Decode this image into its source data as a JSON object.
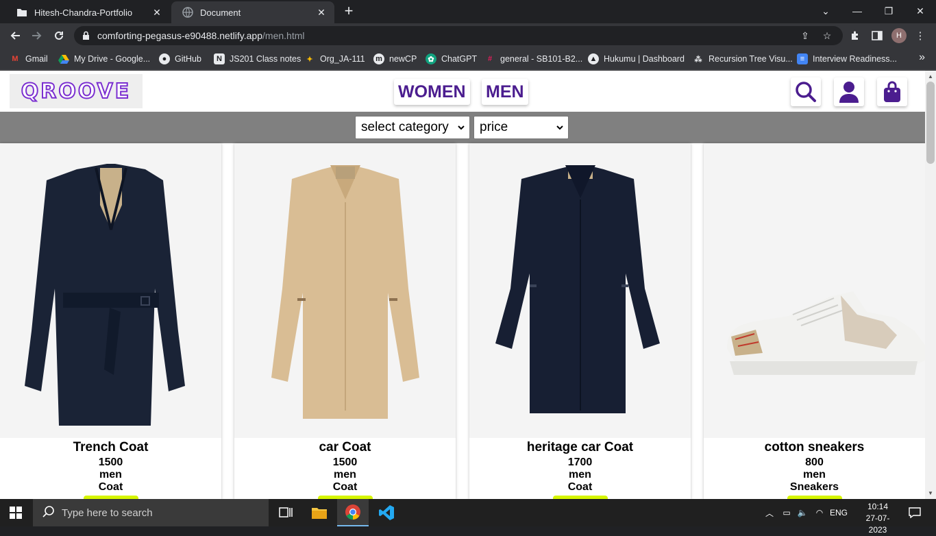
{
  "browser": {
    "tabs": [
      {
        "title": "Hitesh-Chandra-Portfolio",
        "icon": "folder-icon",
        "active": false
      },
      {
        "title": "Document",
        "icon": "globe-icon",
        "active": true
      }
    ],
    "url_host": "comforting-pegasus-e90488.netlify.app",
    "url_path": "/men.html",
    "profile_initial": "H",
    "bookmarks": [
      {
        "label": "Gmail",
        "icon": "gmail-icon"
      },
      {
        "label": "My Drive - Google...",
        "icon": "drive-icon"
      },
      {
        "label": "GitHub",
        "icon": "github-icon"
      },
      {
        "label": "JS201 Class notes",
        "icon": "notion-icon"
      },
      {
        "label": "Org_JA-111",
        "icon": "sparkle-icon"
      },
      {
        "label": "newCP",
        "icon": "m-icon"
      },
      {
        "label": "ChatGPT",
        "icon": "chatgpt-icon"
      },
      {
        "label": "general - SB101-B2...",
        "icon": "slack-icon"
      },
      {
        "label": "Hukumu | Dashboard",
        "icon": "triangle-icon"
      },
      {
        "label": "Recursion Tree Visu...",
        "icon": "tree-icon"
      },
      {
        "label": "Interview Readiness...",
        "icon": "doc-icon"
      }
    ]
  },
  "site": {
    "logo": "QROOVE",
    "nav": {
      "women": "WOMEN",
      "men": "MEN"
    },
    "filters": {
      "category": "select category",
      "price": "price"
    },
    "accent": "#4b1d8f",
    "products": [
      {
        "name": "Trench Coat",
        "price": "1500",
        "gender": "men",
        "category": "Coat"
      },
      {
        "name": "car Coat",
        "price": "1500",
        "gender": "men",
        "category": "Coat"
      },
      {
        "name": "heritage car Coat",
        "price": "1700",
        "gender": "men",
        "category": "Coat"
      },
      {
        "name": "cotton sneakers",
        "price": "800",
        "gender": "men",
        "category": "Sneakers"
      }
    ]
  },
  "taskbar": {
    "search_placeholder": "Type here to search",
    "language": "ENG",
    "time": "10:14",
    "date": "27-07-2023"
  }
}
